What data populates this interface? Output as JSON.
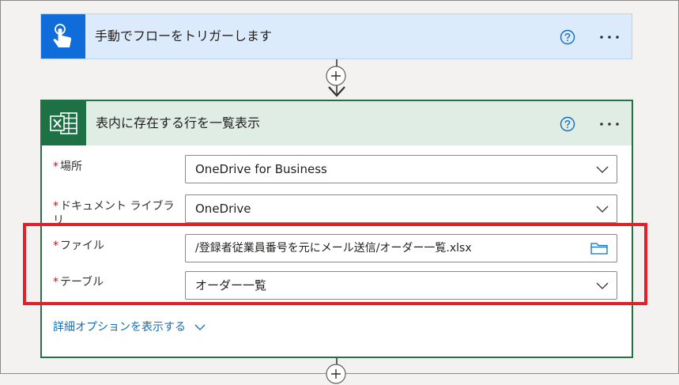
{
  "trigger": {
    "title": "手動でフローをトリガーします",
    "icon": "touch-hand-icon",
    "accent": "#0f6cd9"
  },
  "action": {
    "title": "表内に存在する行を一覧表示",
    "icon": "excel-icon",
    "accent": "#217346",
    "fields": [
      {
        "label": "場所",
        "value": "OneDrive for Business",
        "control": "dropdown"
      },
      {
        "label": "ドキュメント ライブラリ",
        "value": "OneDrive",
        "control": "dropdown"
      },
      {
        "label": "ファイル",
        "value": "/登録者従業員番号を元にメール送信/オーダー一覧.xlsx",
        "control": "file-picker"
      },
      {
        "label": "テーブル",
        "value": "オーダー一覧",
        "control": "dropdown"
      }
    ],
    "required_mark": "*",
    "advanced_label": "詳細オプションを表示する"
  },
  "highlight_color": "#e0202a"
}
